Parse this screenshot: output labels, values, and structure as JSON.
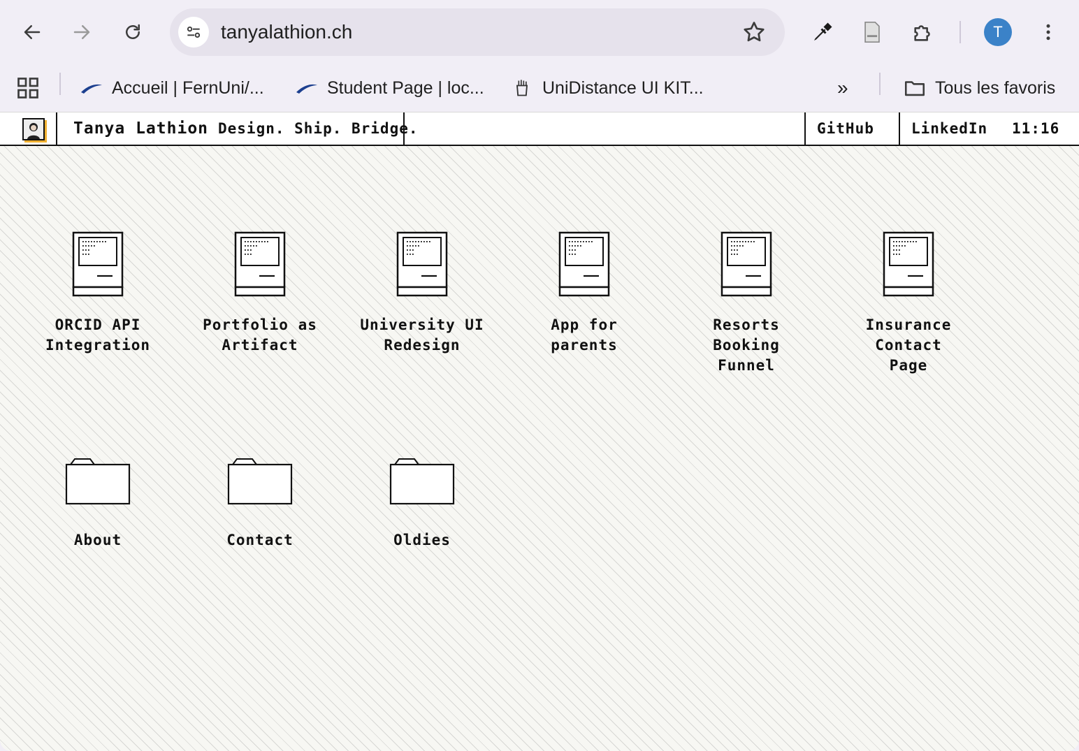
{
  "browser": {
    "url": "tanyalathion.ch",
    "profile_initial": "T",
    "bookmarks": [
      {
        "label": "Accueil | FernUni/...",
        "icon": "swoosh-icon"
      },
      {
        "label": "Student Page | loc...",
        "icon": "swoosh-icon"
      },
      {
        "label": "UniDistance UI KIT...",
        "icon": "pencil-cup-icon"
      }
    ],
    "more_label": "»",
    "all_bookmarks_label": "Tous les favoris"
  },
  "site": {
    "name": "Tanya Lathion",
    "tagline": "Design. Ship. Bridge.",
    "links": [
      "GitHub",
      "LinkedIn"
    ],
    "clock": "11:16"
  },
  "desktop": {
    "projects": [
      {
        "line1": "ORCID API",
        "line2": "Integration",
        "line3": ""
      },
      {
        "line1": "Portfolio as",
        "line2": "Artifact",
        "line3": ""
      },
      {
        "line1": "University UI",
        "line2": "Redesign",
        "line3": ""
      },
      {
        "line1": "App for",
        "line2": "parents",
        "line3": ""
      },
      {
        "line1": "Resorts",
        "line2": "Booking",
        "line3": "Funnel"
      },
      {
        "line1": "Insurance",
        "line2": "Contact",
        "line3": "Page"
      }
    ],
    "folders": [
      "About",
      "Contact",
      "Oldies"
    ]
  },
  "colors": {
    "chrome_bg": "#f1eef6",
    "omnibox_bg": "#e6e2ec",
    "profile": "#3b82c8",
    "desktop_bg": "#f7f7f3",
    "avatar_accent": "#f0b030"
  }
}
